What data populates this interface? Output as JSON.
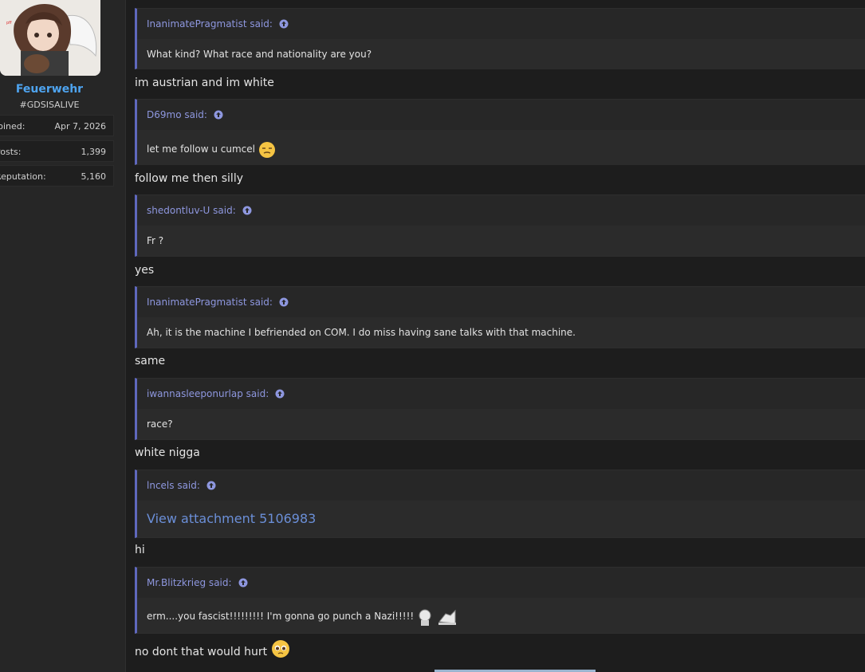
{
  "profile": {
    "username": "Feuerwehr",
    "title": "#GDSISALIVE",
    "stats": [
      {
        "label": "Joined:",
        "value": "Apr 7, 2026"
      },
      {
        "label": "Posts:",
        "value": "1,399"
      },
      {
        "label": "Reputation:",
        "value": "5,160"
      }
    ]
  },
  "thread": [
    {
      "type": "quote",
      "author": "InanimatePragmatist said:",
      "text": "What kind? What race and nationality are you?"
    },
    {
      "type": "reply",
      "text": "im austrian and im white"
    },
    {
      "type": "quote",
      "author": "D69mo said:",
      "text": "let me follow u cumcel",
      "emoji": "unamused-face-emoji"
    },
    {
      "type": "reply",
      "text": "follow me then silly"
    },
    {
      "type": "quote",
      "author": "shedontluv-U said:",
      "text": "Fr ?"
    },
    {
      "type": "reply",
      "text": "yes"
    },
    {
      "type": "quote",
      "author": "InanimatePragmatist said:",
      "text": "Ah, it is the machine I befriended on COM. I do miss having sane talks with that machine."
    },
    {
      "type": "reply",
      "text": "same"
    },
    {
      "type": "quote",
      "author": "iwannasleeponurlap said:",
      "text": "race?"
    },
    {
      "type": "reply",
      "text": "white nigga"
    },
    {
      "type": "quote",
      "author": "lncels said:",
      "link": "View attachment 5106983"
    },
    {
      "type": "reply",
      "text": "hi"
    },
    {
      "type": "quote",
      "author": "Mr.Blitzkrieg said:",
      "text": "erm....you fascist!!!!!!!!! I'm gonna go punch a Nazi!!!!!",
      "emoji": "punch-emotes"
    },
    {
      "type": "reply",
      "text": "no dont that would hurt",
      "emoji": "pleading-face-emoji"
    }
  ],
  "colors": {
    "quote_border": "#5f68bd",
    "author_link": "#8e97df",
    "username": "#4ea4f0",
    "background": "#1d1d1d"
  }
}
